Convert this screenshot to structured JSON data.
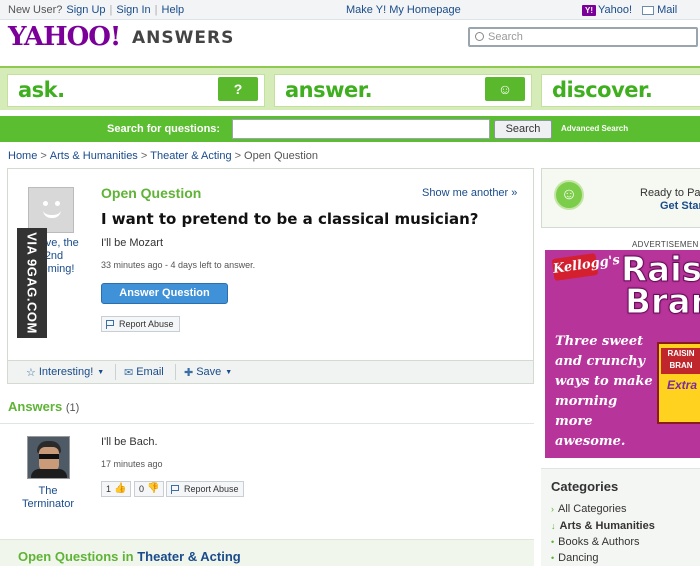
{
  "topbar": {
    "new_user": "New User?",
    "sign_up": "Sign Up",
    "sign_in": "Sign In",
    "help": "Help",
    "make_homepage": "Make Y! My Homepage",
    "yahoo_link": "Yahoo!",
    "mail_link": "Mail",
    "separator": "|"
  },
  "header": {
    "logo": "YAHOO!",
    "logo_sub": "ANSWERS",
    "search_placeholder": "Search"
  },
  "nav": {
    "ask": "ask.",
    "answer": "answer.",
    "discover": "discover.",
    "ask_badge": "?",
    "answer_badge": "☺"
  },
  "searchbar": {
    "label": "Search for questions:",
    "button": "Search",
    "advanced": "Advanced Search"
  },
  "breadcrumb": {
    "items": [
      "Home",
      "Arts & Humanities",
      "Theater & Acting",
      "Open Question"
    ],
    "sep": ">"
  },
  "question": {
    "status": "Open Question",
    "show_another": "Show me another »",
    "title": "I want to pretend to be a classical musician?",
    "body": "I'll be Mozart",
    "time": "33 minutes ago - 4 days left to answer.",
    "answer_button": "Answer Question",
    "report_button": "Report Abuse",
    "asker_name": "Steve, the 2nd Coming!",
    "watermark": "VIA 9GAG.COM",
    "actions": {
      "interesting": "Interesting!",
      "email": "Email",
      "save": "Save"
    }
  },
  "answers": {
    "heading": "Answers",
    "count": "(1)",
    "items": [
      {
        "user": "The Terminator",
        "body": "I'll be Bach.",
        "time": "17 minutes ago",
        "thumbs_up": "1",
        "thumbs_down": "0",
        "report": "Report Abuse"
      }
    ]
  },
  "open_questions": {
    "prefix": "Open Questions in",
    "category": "Theater & Acting"
  },
  "sidebar": {
    "ready_text": "Ready to Pa",
    "get_started": "Get Star",
    "ad_label": "ADVERTISEMEN",
    "ad": {
      "brand": "Kellogg's",
      "product_line1": "Raisin",
      "product_line2": "Bran",
      "tagline": "Three sweet and crunchy ways to make morning more awesome.",
      "box_text": "RAISIN BRAN",
      "box_extra": "Extra"
    },
    "categories": {
      "heading": "Categories",
      "items": [
        "All Categories",
        "Arts & Humanities",
        "Books & Authors",
        "Dancing"
      ]
    }
  },
  "colors": {
    "brand_purple": "#7b0099",
    "green": "#5fb336",
    "link_blue": "#1a4c8b",
    "button_blue": "#3f91d8"
  }
}
